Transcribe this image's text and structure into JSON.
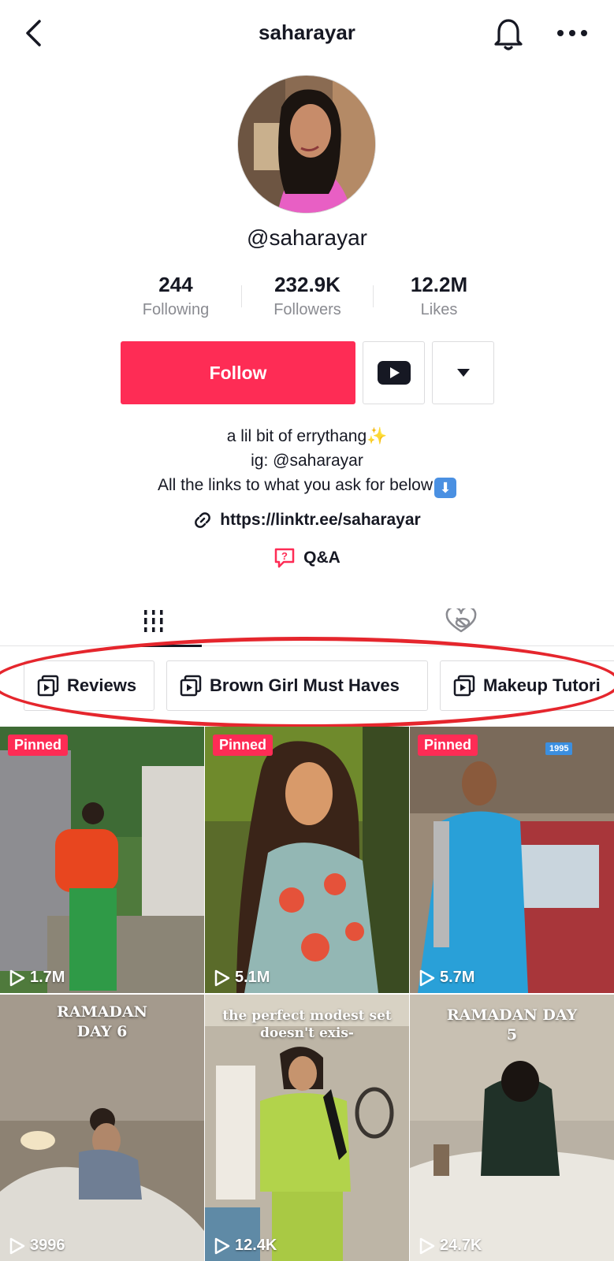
{
  "header": {
    "username": "saharayar"
  },
  "profile": {
    "handle": "@saharayar",
    "stats": [
      {
        "value": "244",
        "label": "Following"
      },
      {
        "value": "232.9K",
        "label": "Followers"
      },
      {
        "value": "12.2M",
        "label": "Likes"
      }
    ],
    "follow_label": "Follow",
    "bio_lines": [
      "a lil bit of errythang",
      "ig: @saharayar",
      "All the links to what you ask for below"
    ],
    "link": "https://linktr.ee/saharayar",
    "qa_label": "Q&A"
  },
  "playlists": [
    "Reviews",
    "Brown Girl Must Haves",
    "Makeup Tutori"
  ],
  "videos": [
    {
      "badge": "Pinned",
      "views": "1.7M",
      "overlay": ""
    },
    {
      "badge": "Pinned",
      "views": "5.1M",
      "overlay": ""
    },
    {
      "badge": "Pinned",
      "views": "5.7M",
      "overlay": "",
      "tag": "1995"
    },
    {
      "badge": "",
      "views": "3996",
      "overlay_lines": [
        "RAMADAN",
        "DAY 6"
      ]
    },
    {
      "badge": "",
      "views": "12.4K",
      "overlay_lines": [
        "the perfect modest set",
        "doesn't exis-"
      ]
    },
    {
      "badge": "",
      "views": "24.7K",
      "overlay_lines": [
        "RAMADAN DAY",
        "5"
      ]
    }
  ],
  "colors": {
    "accent": "#fe2c55",
    "highlight": "#e5262d",
    "muted": "#8a8b91"
  },
  "icons": [
    "back-arrow-icon",
    "bell-icon",
    "more-icon",
    "youtube-icon",
    "caret-down-icon",
    "link-icon",
    "qa-icon",
    "grid-icon",
    "liked-hidden-icon",
    "playlist-icon",
    "play-icon"
  ]
}
